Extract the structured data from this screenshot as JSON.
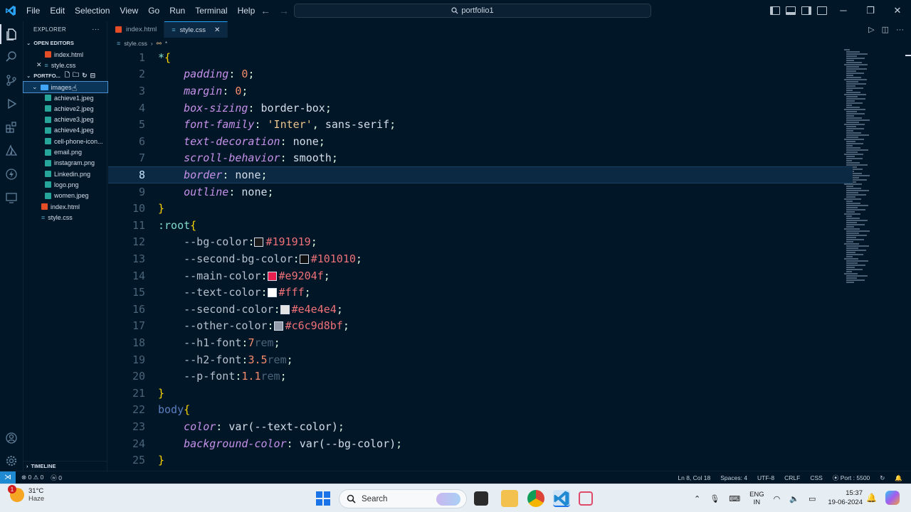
{
  "titlebar": {
    "menus": [
      "File",
      "Edit",
      "Selection",
      "View",
      "Go",
      "Run",
      "Terminal",
      "Help"
    ],
    "search_text": "portfolio1"
  },
  "sidebar": {
    "explorer_label": "EXPLORER",
    "open_editors_label": "OPEN EDITORS",
    "open_editors": [
      {
        "name": "index.html",
        "type": "html"
      },
      {
        "name": "style.css",
        "type": "css"
      }
    ],
    "folder_label": "PORTFO...",
    "images_folder": "images",
    "image_files": [
      "achieve1.jpeg",
      "achieve2.jpeg",
      "achieve3.jpeg",
      "achieve4.jpeg",
      "cell-phone-icon...",
      "email.png",
      "instagram.png",
      "Linkedin.png",
      "logo.png",
      "women.jpeg"
    ],
    "root_files": [
      {
        "name": "index.html",
        "type": "html"
      },
      {
        "name": "style.css",
        "type": "css"
      }
    ],
    "timeline_label": "TIMELINE"
  },
  "tabs": [
    {
      "label": "index.html",
      "active": false
    },
    {
      "label": "style.css",
      "active": true
    }
  ],
  "breadcrumb": {
    "file": "style.css",
    "symbol": "*"
  },
  "editor": {
    "current_line": 8,
    "lines": [
      {
        "n": 1,
        "parts": [
          [
            "sel",
            "*"
          ],
          [
            "yellow",
            "{"
          ]
        ]
      },
      {
        "n": 2,
        "parts": [
          [
            "sp",
            "    "
          ],
          [
            "prop",
            "padding"
          ],
          [
            "punct",
            ": "
          ],
          [
            "num",
            "0"
          ],
          [
            "punct",
            ";"
          ]
        ]
      },
      {
        "n": 3,
        "parts": [
          [
            "sp",
            "    "
          ],
          [
            "prop",
            "margin"
          ],
          [
            "punct",
            ": "
          ],
          [
            "num",
            "0"
          ],
          [
            "punct",
            ";"
          ]
        ]
      },
      {
        "n": 4,
        "parts": [
          [
            "sp",
            "    "
          ],
          [
            "prop",
            "box-sizing"
          ],
          [
            "punct",
            ": "
          ],
          [
            "val",
            "border-box"
          ],
          [
            "punct",
            ";"
          ]
        ]
      },
      {
        "n": 5,
        "parts": [
          [
            "sp",
            "    "
          ],
          [
            "prop",
            "font-family"
          ],
          [
            "punct",
            ": "
          ],
          [
            "str",
            "'Inter'"
          ],
          [
            "punct",
            ", "
          ],
          [
            "val",
            "sans-serif"
          ],
          [
            "punct",
            ";"
          ]
        ]
      },
      {
        "n": 6,
        "parts": [
          [
            "sp",
            "    "
          ],
          [
            "prop",
            "text-decoration"
          ],
          [
            "punct",
            ": "
          ],
          [
            "val",
            "none"
          ],
          [
            "punct",
            ";"
          ]
        ]
      },
      {
        "n": 7,
        "parts": [
          [
            "sp",
            "    "
          ],
          [
            "prop",
            "scroll-behavior"
          ],
          [
            "punct",
            ": "
          ],
          [
            "val",
            "smooth"
          ],
          [
            "punct",
            ";"
          ]
        ]
      },
      {
        "n": 8,
        "parts": [
          [
            "sp",
            "    "
          ],
          [
            "prop",
            "border"
          ],
          [
            "punct",
            ": "
          ],
          [
            "val",
            "none"
          ],
          [
            "punct",
            ";"
          ]
        ]
      },
      {
        "n": 9,
        "parts": [
          [
            "sp",
            "    "
          ],
          [
            "prop",
            "outline"
          ],
          [
            "punct",
            ": "
          ],
          [
            "val",
            "none"
          ],
          [
            "punct",
            ";"
          ]
        ]
      },
      {
        "n": 10,
        "parts": [
          [
            "yellow",
            "}"
          ]
        ]
      },
      {
        "n": 11,
        "parts": [
          [
            "sel",
            ":root"
          ],
          [
            "yellow",
            "{"
          ]
        ]
      },
      {
        "n": 12,
        "parts": [
          [
            "sp",
            "    "
          ],
          [
            "var",
            "--bg-color"
          ],
          [
            "punct",
            ":"
          ],
          [
            "swatch",
            "#191919"
          ],
          [
            "hex",
            "#191919"
          ],
          [
            "punct",
            ";"
          ]
        ]
      },
      {
        "n": 13,
        "parts": [
          [
            "sp",
            "    "
          ],
          [
            "var",
            "--second-bg-color"
          ],
          [
            "punct",
            ":"
          ],
          [
            "swatch",
            "#101010"
          ],
          [
            "hex",
            "#101010"
          ],
          [
            "punct",
            ";"
          ]
        ]
      },
      {
        "n": 14,
        "parts": [
          [
            "sp",
            "    "
          ],
          [
            "var",
            "--main-color"
          ],
          [
            "punct",
            ":"
          ],
          [
            "swatch",
            "#e9204f"
          ],
          [
            "hex",
            "#e9204f"
          ],
          [
            "punct",
            ";"
          ]
        ]
      },
      {
        "n": 15,
        "parts": [
          [
            "sp",
            "    "
          ],
          [
            "var",
            "--text-color"
          ],
          [
            "punct",
            ":"
          ],
          [
            "swatch",
            "#fff"
          ],
          [
            "hex",
            "#fff"
          ],
          [
            "punct",
            ";"
          ]
        ]
      },
      {
        "n": 16,
        "parts": [
          [
            "sp",
            "    "
          ],
          [
            "var",
            "--second-color"
          ],
          [
            "punct",
            ":"
          ],
          [
            "swatch",
            "#e4e4e4"
          ],
          [
            "hex",
            "#e4e4e4"
          ],
          [
            "punct",
            ";"
          ]
        ]
      },
      {
        "n": 17,
        "parts": [
          [
            "sp",
            "    "
          ],
          [
            "var",
            "--other-color"
          ],
          [
            "punct",
            ":"
          ],
          [
            "swatch",
            "#c6c9d8bf"
          ],
          [
            "hex",
            "#c6c9d8bf"
          ],
          [
            "punct",
            ";"
          ]
        ]
      },
      {
        "n": 18,
        "parts": [
          [
            "sp",
            "    "
          ],
          [
            "var",
            "--h1-font"
          ],
          [
            "punct",
            ":"
          ],
          [
            "num",
            "7"
          ],
          [
            "unit",
            "rem"
          ],
          [
            "punct",
            ";"
          ]
        ]
      },
      {
        "n": 19,
        "parts": [
          [
            "sp",
            "    "
          ],
          [
            "var",
            "--h2-font"
          ],
          [
            "punct",
            ":"
          ],
          [
            "num",
            "3.5"
          ],
          [
            "unit",
            "rem"
          ],
          [
            "punct",
            ";"
          ]
        ]
      },
      {
        "n": 20,
        "parts": [
          [
            "sp",
            "    "
          ],
          [
            "var",
            "--p-font"
          ],
          [
            "punct",
            ":"
          ],
          [
            "num",
            "1.1"
          ],
          [
            "unit",
            "rem"
          ],
          [
            "punct",
            ";"
          ]
        ]
      },
      {
        "n": 21,
        "parts": [
          [
            "yellow",
            "}"
          ]
        ]
      },
      {
        "n": 22,
        "parts": [
          [
            "selbody",
            "body"
          ],
          [
            "yellow",
            "{"
          ]
        ]
      },
      {
        "n": 23,
        "parts": [
          [
            "sp",
            "    "
          ],
          [
            "prop",
            "color"
          ],
          [
            "punct",
            ": "
          ],
          [
            "val",
            "var(--text-color)"
          ],
          [
            "punct",
            ";"
          ]
        ]
      },
      {
        "n": 24,
        "parts": [
          [
            "sp",
            "    "
          ],
          [
            "prop",
            "background-color"
          ],
          [
            "punct",
            ": "
          ],
          [
            "val",
            "var(--bg-color)"
          ],
          [
            "punct",
            ";"
          ]
        ]
      },
      {
        "n": 25,
        "parts": [
          [
            "yellow",
            "}"
          ]
        ]
      }
    ]
  },
  "statusbar": {
    "errors": "0",
    "warnings": "0",
    "ports_count": "0",
    "position": "Ln 8, Col 18",
    "spaces": "Spaces: 4",
    "encoding": "UTF-8",
    "eol": "CRLF",
    "language": "CSS",
    "port": "Port : 5500"
  },
  "taskbar": {
    "weather_temp": "31°C",
    "weather_desc": "Haze",
    "weather_badge": "1",
    "search_label": "Search",
    "lang_line1": "ENG",
    "lang_line2": "IN",
    "time": "15:37",
    "date": "19-06-2024"
  },
  "colors": {
    "accent": "#21a6ff",
    "editor_bg": "#011627",
    "current_line_bg": "#0b2942"
  }
}
